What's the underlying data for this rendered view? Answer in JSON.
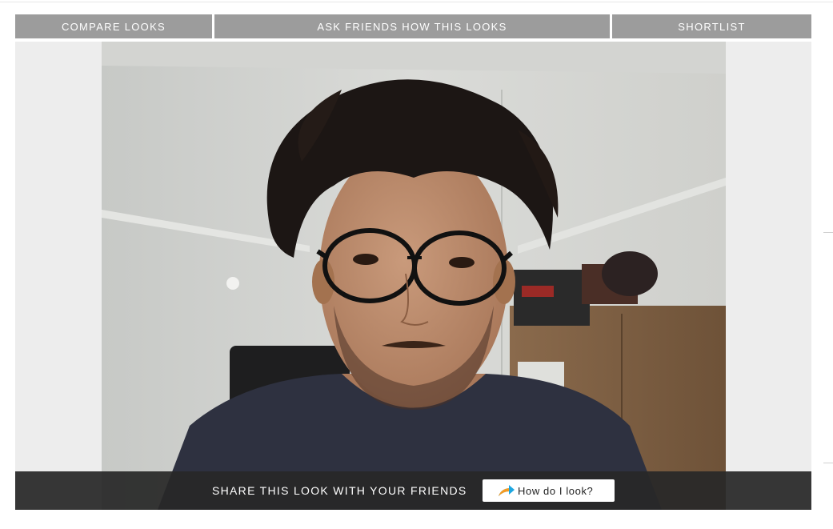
{
  "tabs": {
    "compare_label": "COMPARE LOOKS",
    "ask_label": "ASK FRIENDS HOW THIS LOOKS",
    "shortlist_label": "SHORTLIST"
  },
  "share": {
    "prompt": "SHARE THIS LOOK WITH YOUR FRIENDS",
    "button_label": "How do I look?",
    "button_icon": "share-arrow-icon"
  },
  "colors": {
    "tab_bg": "#9c9c9c",
    "share_bar_bg": "#282828",
    "icon_orange": "#f59b23",
    "icon_blue": "#1ea7e1"
  }
}
